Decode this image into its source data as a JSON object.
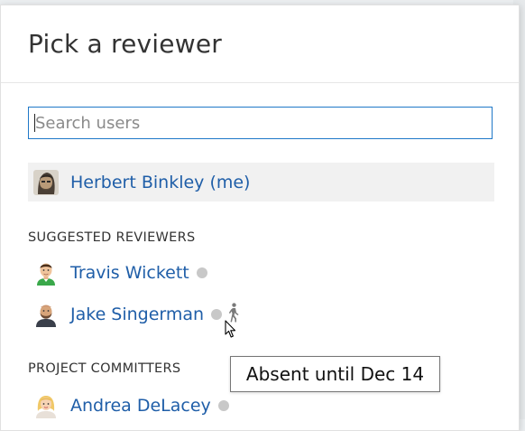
{
  "dialog": {
    "title": "Pick a reviewer",
    "search": {
      "placeholder": "Search users",
      "value": ""
    },
    "current_user": {
      "name": "Herbert Binkley (me)",
      "avatar": "avatar-herbert"
    },
    "suggested": {
      "header": "SUGGESTED REVIEWERS",
      "users": [
        {
          "name": "Travis Wickett",
          "avatar": "avatar-travis",
          "presence": "offline"
        },
        {
          "name": "Jake Singerman",
          "avatar": "avatar-jake",
          "presence": "offline",
          "status_icon": "walking-person-icon"
        }
      ]
    },
    "committers": {
      "header": "PROJECT COMMITTERS",
      "users": [
        {
          "name": "Andrea DeLacey",
          "avatar": "avatar-andrea",
          "presence": "offline"
        }
      ]
    }
  },
  "tooltip": {
    "text": "Absent until Dec 14"
  },
  "colors": {
    "link": "#1f5ea8",
    "search_border": "#1f78c8",
    "presence_offline": "#c8c8c8",
    "me_row_bg": "#f1f1f1"
  }
}
